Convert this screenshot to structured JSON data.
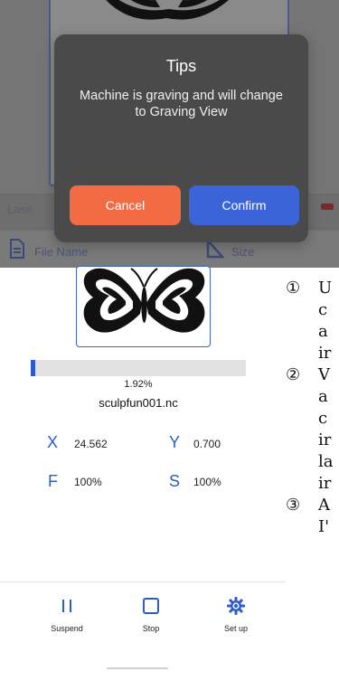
{
  "dialog": {
    "title": "Tips",
    "message": "Machine is graving and will change to Graving View",
    "cancel_label": "Cancel",
    "confirm_label": "Confirm"
  },
  "background": {
    "laser_label": "Lase",
    "file_name_label": "File Name",
    "size_label": "Size"
  },
  "job": {
    "progress_percent": 1.92,
    "progress_text": "1.92%",
    "file_name": "sculpfun001.nc"
  },
  "coords": {
    "x_label": "X",
    "x_value": "24.562",
    "y_label": "Y",
    "y_value": "0.700",
    "f_label": "F",
    "f_value": "100%",
    "s_label": "S",
    "s_value": "100%"
  },
  "bottom_bar": {
    "suspend_label": "Suspend",
    "stop_label": "Stop",
    "setup_label": "Set up"
  },
  "doc_side": {
    "item1_num": "①",
    "item1_lines": [
      "U",
      "c",
      "a",
      "ir"
    ],
    "item2_num": "②",
    "item2_lines": [
      "V",
      "a",
      "c",
      "ir",
      "la",
      "ir"
    ],
    "item3_num": "③",
    "item3_lines": [
      "A",
      "I'"
    ]
  },
  "colors": {
    "accent_blue": "#2c5cc9",
    "cancel_orange": "#f36b43",
    "confirm_blue": "#3a64d8"
  }
}
